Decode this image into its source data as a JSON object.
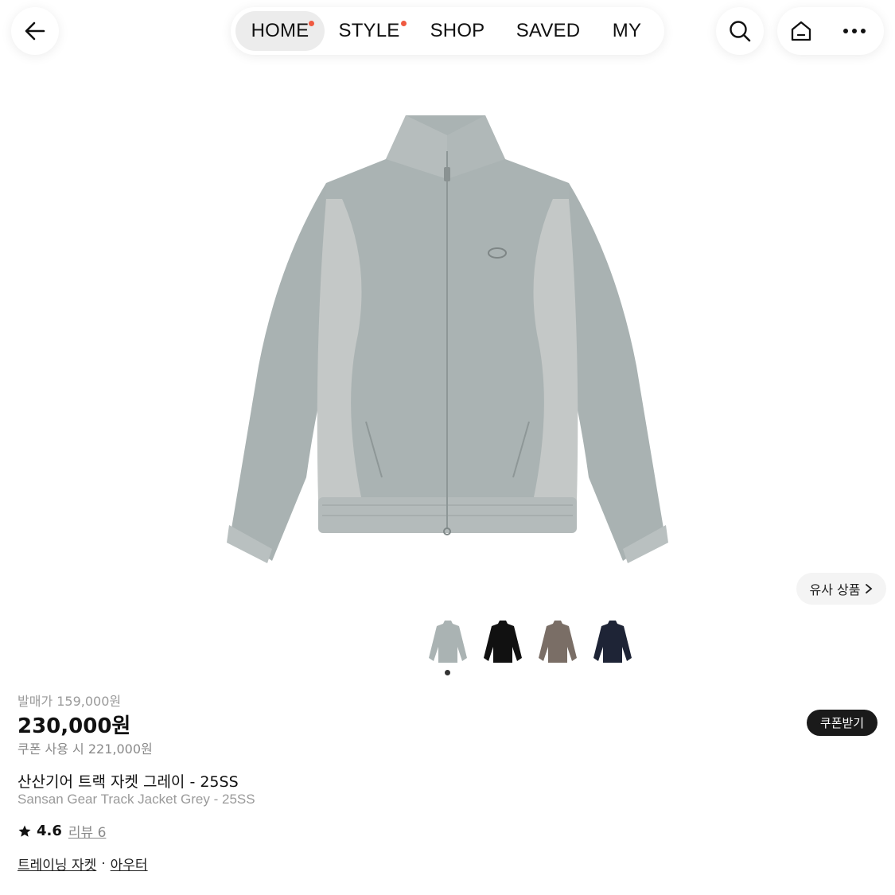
{
  "nav": {
    "tabs": [
      {
        "label": "HOME",
        "active": true,
        "new_dot": true
      },
      {
        "label": "STYLE",
        "active": false,
        "new_dot": true
      },
      {
        "label": "SHOP",
        "active": false,
        "new_dot": false
      },
      {
        "label": "SAVED",
        "active": false,
        "new_dot": false
      },
      {
        "label": "MY",
        "active": false,
        "new_dot": false
      }
    ],
    "icons": {
      "back": "arrow-left-icon",
      "search": "search-icon",
      "home": "home-icon",
      "more": "more-dots-icon"
    }
  },
  "product": {
    "similar_label": "유사 상품",
    "thumbnail_colors": [
      "#aab3b3",
      "#111111",
      "#7a6e66",
      "#1e2436"
    ],
    "selected_thumbnail": 1,
    "release_price": "발매가 159,000원",
    "price": "230,000원",
    "coupon_price": "쿠폰 사용 시 221,000원",
    "coupon_button": "쿠폰받기",
    "name_ko": "산산기어 트랙 자켓 그레이 - 25SS",
    "name_en": "Sansan Gear Track Jacket Grey - 25SS",
    "rating": "4.6",
    "reviews": "리뷰 6",
    "categories": [
      "트레이닝 자켓",
      "아우터"
    ],
    "category_separator": "·"
  },
  "colors": {
    "accent_dot": "#ef5a41",
    "jacket_main": "#aab3b3",
    "jacket_panel": "#c4c8c7"
  }
}
